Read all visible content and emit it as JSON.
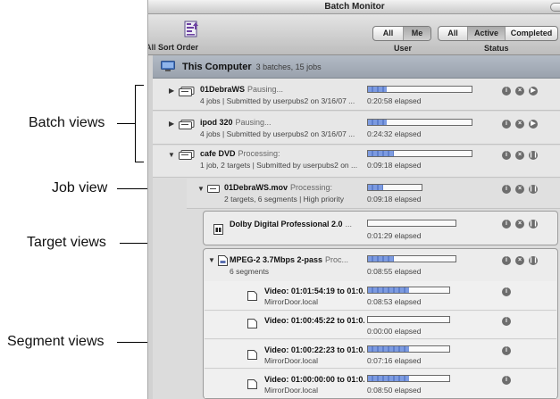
{
  "window": {
    "title": "Batch Monitor"
  },
  "toolbar": {
    "all_label": "All",
    "sort_order_label": "Sort Order",
    "user_filter": {
      "options": [
        "All",
        "Me"
      ],
      "selected": "Me",
      "label": "User"
    },
    "status_filter": {
      "options": [
        "All",
        "Active",
        "Completed"
      ],
      "selected": "Active",
      "label": "Status"
    }
  },
  "group": {
    "title": "This Computer",
    "subtitle": "3 batches, 15 jobs"
  },
  "batches": [
    {
      "name": "01DebraWS",
      "status": "Pausing...",
      "info": "4 jobs  |  Submitted by userpubs2 on 3/16/07 ...",
      "progress": 0.18,
      "elapsed": "0:20:58 elapsed",
      "control": "play"
    },
    {
      "name": "ipod 320",
      "status": "Pausing...",
      "info": "4 jobs  |  Submitted by userpubs2 on 3/16/07 ...",
      "progress": 0.18,
      "elapsed": "0:24:32 elapsed",
      "control": "play"
    },
    {
      "name": "cafe DVD",
      "status": "Processing:",
      "info": "1 job, 2 targets  |  Submitted by userpubs2 on ...",
      "progress": 0.25,
      "elapsed": "0:09:18 elapsed",
      "control": "pause"
    }
  ],
  "job": {
    "name": "01DebraWS.mov",
    "status": "Processing:",
    "info": "2 targets, 6 segments  |  High priority",
    "progress": 0.28,
    "elapsed": "0:09:18 elapsed",
    "control": "pause"
  },
  "targets": [
    {
      "name": "Dolby Digital Professional 2.0",
      "status": "...",
      "info": "",
      "progress": 0.0,
      "elapsed": "0:01:29 elapsed"
    },
    {
      "name": "MPEG-2 3.7Mbps 2-pass",
      "status": "Proc...",
      "info": "6 segments",
      "progress": 0.3,
      "elapsed": "0:08:55 elapsed",
      "control": "pause"
    }
  ],
  "segments": [
    {
      "name": "Video: 01:01:54:19 to 01:0...",
      "host": "MirrorDoor.local",
      "progress": 0.5,
      "elapsed": "0:08:53 elapsed"
    },
    {
      "name": "Video: 01:00:45:22 to 01:0...",
      "host": "",
      "progress": 0.0,
      "elapsed": "0:00:00 elapsed"
    },
    {
      "name": "Video: 01:00:22:23 to 01:0...",
      "host": "MirrorDoor.local",
      "progress": 0.5,
      "elapsed": "0:07:16 elapsed"
    },
    {
      "name": "Video: 01:00:00:00 to 01:0...",
      "host": "MirrorDoor.local",
      "progress": 0.5,
      "elapsed": "0:08:50 elapsed"
    }
  ],
  "callouts": {
    "batch_views": "Batch views",
    "job_view": "Job view",
    "target_views": "Target views",
    "segment_views": "Segment views"
  },
  "icons": {
    "info": "i",
    "cancel": "×",
    "play": "▶",
    "pause": "❙❙",
    "disclosure_open": "▼",
    "disclosure_closed": "▶"
  }
}
